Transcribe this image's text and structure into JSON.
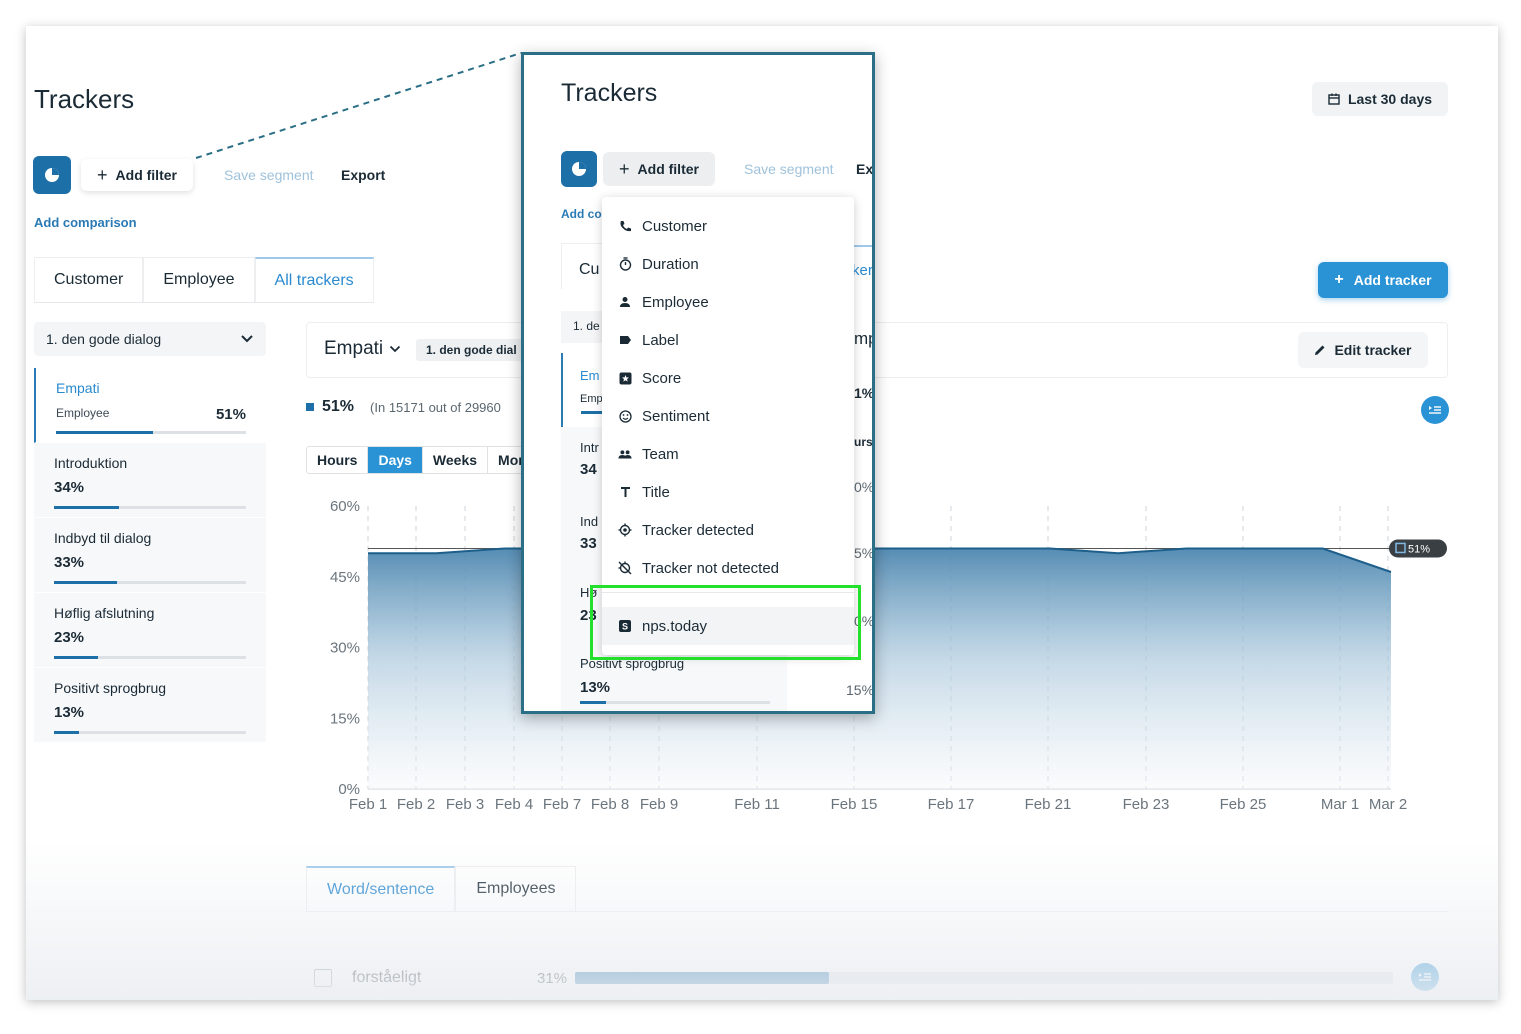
{
  "app": {
    "title": "Trackers",
    "date_range": "Last 30 days",
    "add_filter": "Add filter",
    "save_segment": "Save segment",
    "export": "Export",
    "add_comparison": "Add comparison",
    "add_tracker": "Add tracker",
    "edit_tracker": "Edit tracker"
  },
  "tabs": [
    "Customer",
    "Employee",
    "All trackers"
  ],
  "segment_select": "1. den gode dialog",
  "trackers": [
    {
      "name": "Empati",
      "sub": "Employee",
      "pct": "51%",
      "value": 0.51
    },
    {
      "name": "Introduktion",
      "pct": "34%",
      "value": 0.34
    },
    {
      "name": "Indbyd til dialog",
      "pct": "33%",
      "value": 0.33
    },
    {
      "name": "Høflig afslutning",
      "pct": "23%",
      "value": 0.23
    },
    {
      "name": "Positivt sprogbrug",
      "pct": "13%",
      "value": 0.13
    }
  ],
  "chart_header": {
    "tracker": "Empati",
    "segment_chip": "1. den gode dial",
    "summary_pct": "51%",
    "summary_text": "(In 15171 out of 29960"
  },
  "granularity": [
    "Hours",
    "Days",
    "Weeks",
    "Mon"
  ],
  "chart_data": {
    "type": "area",
    "x": [
      "Feb 1",
      "Feb 2",
      "Feb 3",
      "Feb 4",
      "Feb 7",
      "Feb 8",
      "Feb 9",
      "Feb 11",
      "Feb 15",
      "Feb 17",
      "Feb 21",
      "Feb 23",
      "Feb 25",
      "Mar 1",
      "Mar 2"
    ],
    "values": [
      50,
      50,
      51,
      51,
      51,
      51,
      51,
      51,
      51,
      51,
      51,
      50,
      51,
      51,
      51,
      46
    ],
    "series": [
      {
        "name": "Empati",
        "values": [
          50,
          50,
          51,
          51,
          51,
          51,
          51,
          51,
          51,
          51,
          51,
          50,
          51,
          51,
          51,
          46
        ]
      }
    ],
    "y_ticks": [
      "60%",
      "45%",
      "30%",
      "15%",
      "0%"
    ],
    "ylim": [
      0,
      60
    ],
    "reference_label": "51%",
    "grid": true
  },
  "bottom_tabs": [
    "Word/sentence",
    "Employees"
  ],
  "word_rows": [
    {
      "word": "forståeligt",
      "pct": "31%",
      "value": 0.31
    }
  ],
  "zoom": {
    "title": "Trackers",
    "add_filter": "Add filter",
    "save_segment": "Save segment",
    "export_partial": "Ex",
    "add_comparison_partial": "Add co",
    "bg_fragments": {
      "tab_partial": "Cu",
      "trackers_partial": "kers",
      "seg_partial": "1. de",
      "emp_partial": "mp",
      "empati_partial": "Em",
      "emp_sub_partial": "Emp",
      "pct_51": "1%",
      "intro_partial": "Intr",
      "intro_pct": "34",
      "indb_partial": "Ind",
      "indb_pct": "33",
      "hof_partial": "Hø",
      "hof_pct": "23",
      "pos_name": "Positivt sprogbrug",
      "pos_pct": "13%",
      "hours_partial": "urs",
      "y_60": "0%",
      "y_45": "5%",
      "y_30": "0%",
      "y_15": "15%"
    },
    "menu": [
      {
        "label": "Customer",
        "icon": "phone-icon"
      },
      {
        "label": "Duration",
        "icon": "stopwatch-icon"
      },
      {
        "label": "Employee",
        "icon": "person-icon"
      },
      {
        "label": "Label",
        "icon": "tag-icon"
      },
      {
        "label": "Score",
        "icon": "score-icon"
      },
      {
        "label": "Sentiment",
        "icon": "smiley-icon"
      },
      {
        "label": "Team",
        "icon": "team-icon"
      },
      {
        "label": "Title",
        "icon": "title-icon"
      },
      {
        "label": "Tracker detected",
        "icon": "target-icon"
      },
      {
        "label": "Tracker not detected",
        "icon": "target-off-icon"
      },
      {
        "label": "nps.today",
        "icon": "nps-icon"
      }
    ]
  },
  "colors": {
    "primary": "#1d6fa8",
    "accent": "#2a93d5",
    "highlight": "#22e02b",
    "zoom_border": "#2b6f86"
  }
}
